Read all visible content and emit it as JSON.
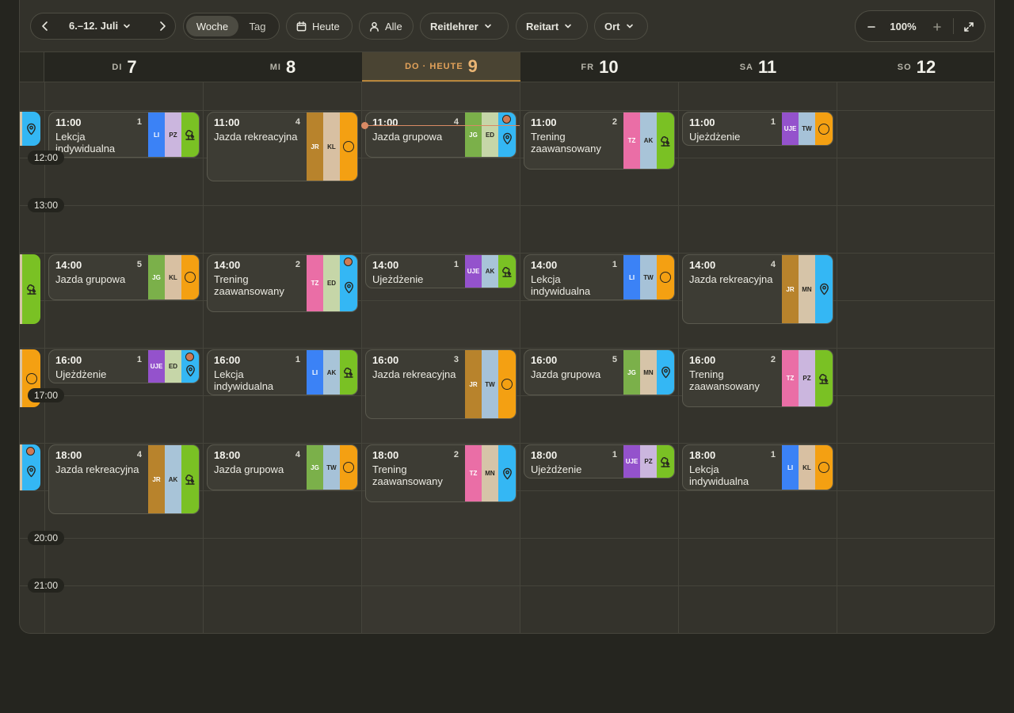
{
  "toolbar": {
    "week_range": "6.–12. Juli",
    "view_week": "Woche",
    "view_day": "Tag",
    "today": "Heute",
    "all": "Alle",
    "filters": [
      {
        "label": "Reitlehrer"
      },
      {
        "label": "Reitart"
      },
      {
        "label": "Ort"
      }
    ],
    "zoom": "100%"
  },
  "days": [
    {
      "weekday": "DI",
      "number": "7",
      "today": false
    },
    {
      "weekday": "MI",
      "number": "8",
      "today": false
    },
    {
      "weekday": "DO · HEUTE",
      "number": "9",
      "today": true
    },
    {
      "weekday": "FR",
      "number": "10",
      "today": false
    },
    {
      "weekday": "SA",
      "number": "11",
      "today": false
    },
    {
      "weekday": "SO",
      "number": "12",
      "today": false
    }
  ],
  "time_labels": [
    "12:00",
    "13:00",
    "17:00",
    "20:00",
    "21:00"
  ],
  "colors": {
    "LI": "#3b82f6",
    "JR": "#b8832c",
    "JG": "#7bb04a",
    "UJE": "#9452cc",
    "TZ": "#ea6ea6",
    "PZ": "#cbb6de",
    "KL": "#d8c0a2",
    "ED": "#c6d6a8",
    "AK": "#a8c4d8",
    "TW": "#a6c2d8",
    "MN": "#d6c4a8",
    "park": "#7ac124",
    "pin": "#34b7f4",
    "ring": "#f4a012",
    "accent": "#e3a25a"
  },
  "events": [
    {
      "day": 0,
      "hour": 11,
      "end": 12.0,
      "time": "11:00",
      "count": "1",
      "title": "Lekcja indywidualna",
      "type": "LI",
      "inst": "PZ",
      "loc": "park",
      "dot": false
    },
    {
      "day": 0,
      "hour": 14,
      "end": 15.0,
      "time": "14:00",
      "count": "5",
      "title": "Jazda grupowa",
      "type": "JG",
      "inst": "KL",
      "loc": "ring",
      "dot": false
    },
    {
      "day": 0,
      "hour": 16,
      "end": 16.75,
      "time": "16:00",
      "count": "1",
      "title": "Ujeżdżenie",
      "type": "UJE",
      "inst": "ED",
      "loc": "pin",
      "dot": true
    },
    {
      "day": 0,
      "hour": 18,
      "end": 19.5,
      "time": "18:00",
      "count": "4",
      "title": "Jazda rekreacyjna",
      "type": "JR",
      "inst": "AK",
      "loc": "park",
      "dot": false
    },
    {
      "day": 1,
      "hour": 11,
      "end": 12.5,
      "time": "11:00",
      "count": "4",
      "title": "Jazda rekreacyjna",
      "type": "JR",
      "inst": "KL",
      "loc": "ring",
      "dot": false
    },
    {
      "day": 1,
      "hour": 14,
      "end": 15.25,
      "time": "14:00",
      "count": "2",
      "title": "Trening zaawansowany",
      "type": "TZ",
      "inst": "ED",
      "loc": "pin",
      "dot": true
    },
    {
      "day": 1,
      "hour": 16,
      "end": 17.0,
      "time": "16:00",
      "count": "1",
      "title": "Lekcja indywidualna",
      "type": "LI",
      "inst": "AK",
      "loc": "park",
      "dot": false
    },
    {
      "day": 1,
      "hour": 18,
      "end": 19.0,
      "time": "18:00",
      "count": "4",
      "title": "Jazda grupowa",
      "type": "JG",
      "inst": "TW",
      "loc": "ring",
      "dot": false
    },
    {
      "day": 2,
      "hour": 11,
      "end": 12.0,
      "time": "11:00",
      "count": "4",
      "title": "Jazda grupowa",
      "type": "JG",
      "inst": "ED",
      "loc": "pin",
      "dot": true
    },
    {
      "day": 2,
      "hour": 14,
      "end": 14.75,
      "time": "14:00",
      "count": "1",
      "title": "Ujeżdżenie",
      "type": "UJE",
      "inst": "AK",
      "loc": "park",
      "dot": false
    },
    {
      "day": 2,
      "hour": 16,
      "end": 17.5,
      "time": "16:00",
      "count": "3",
      "title": "Jazda rekreacyjna",
      "type": "JR",
      "inst": "TW",
      "loc": "ring",
      "dot": false
    },
    {
      "day": 2,
      "hour": 18,
      "end": 19.25,
      "time": "18:00",
      "count": "2",
      "title": "Trening zaawansowany",
      "type": "TZ",
      "inst": "MN",
      "loc": "pin",
      "dot": false
    },
    {
      "day": 3,
      "hour": 11,
      "end": 12.25,
      "time": "11:00",
      "count": "2",
      "title": "Trening zaawansowany",
      "type": "TZ",
      "inst": "AK",
      "loc": "park",
      "dot": false
    },
    {
      "day": 3,
      "hour": 14,
      "end": 15.0,
      "time": "14:00",
      "count": "1",
      "title": "Lekcja indywidualna",
      "type": "LI",
      "inst": "TW",
      "loc": "ring",
      "dot": false
    },
    {
      "day": 3,
      "hour": 16,
      "end": 17.0,
      "time": "16:00",
      "count": "5",
      "title": "Jazda grupowa",
      "type": "JG",
      "inst": "MN",
      "loc": "pin",
      "dot": false
    },
    {
      "day": 3,
      "hour": 18,
      "end": 18.75,
      "time": "18:00",
      "count": "1",
      "title": "Ujeżdżenie",
      "type": "UJE",
      "inst": "PZ",
      "loc": "park",
      "dot": false
    },
    {
      "day": 4,
      "hour": 11,
      "end": 11.75,
      "time": "11:00",
      "count": "1",
      "title": "Ujeżdżenie",
      "type": "UJE",
      "inst": "TW",
      "loc": "ring",
      "dot": false
    },
    {
      "day": 4,
      "hour": 14,
      "end": 15.5,
      "time": "14:00",
      "count": "4",
      "title": "Jazda rekreacyjna",
      "type": "JR",
      "inst": "MN",
      "loc": "pin",
      "dot": false
    },
    {
      "day": 4,
      "hour": 16,
      "end": 17.25,
      "time": "16:00",
      "count": "2",
      "title": "Trening zaawansowany",
      "type": "TZ",
      "inst": "PZ",
      "loc": "park",
      "dot": false
    },
    {
      "day": 4,
      "hour": 18,
      "end": 19.0,
      "time": "18:00",
      "count": "1",
      "title": "Lekcja indywidualna",
      "type": "LI",
      "inst": "KL",
      "loc": "ring",
      "dot": false
    }
  ]
}
